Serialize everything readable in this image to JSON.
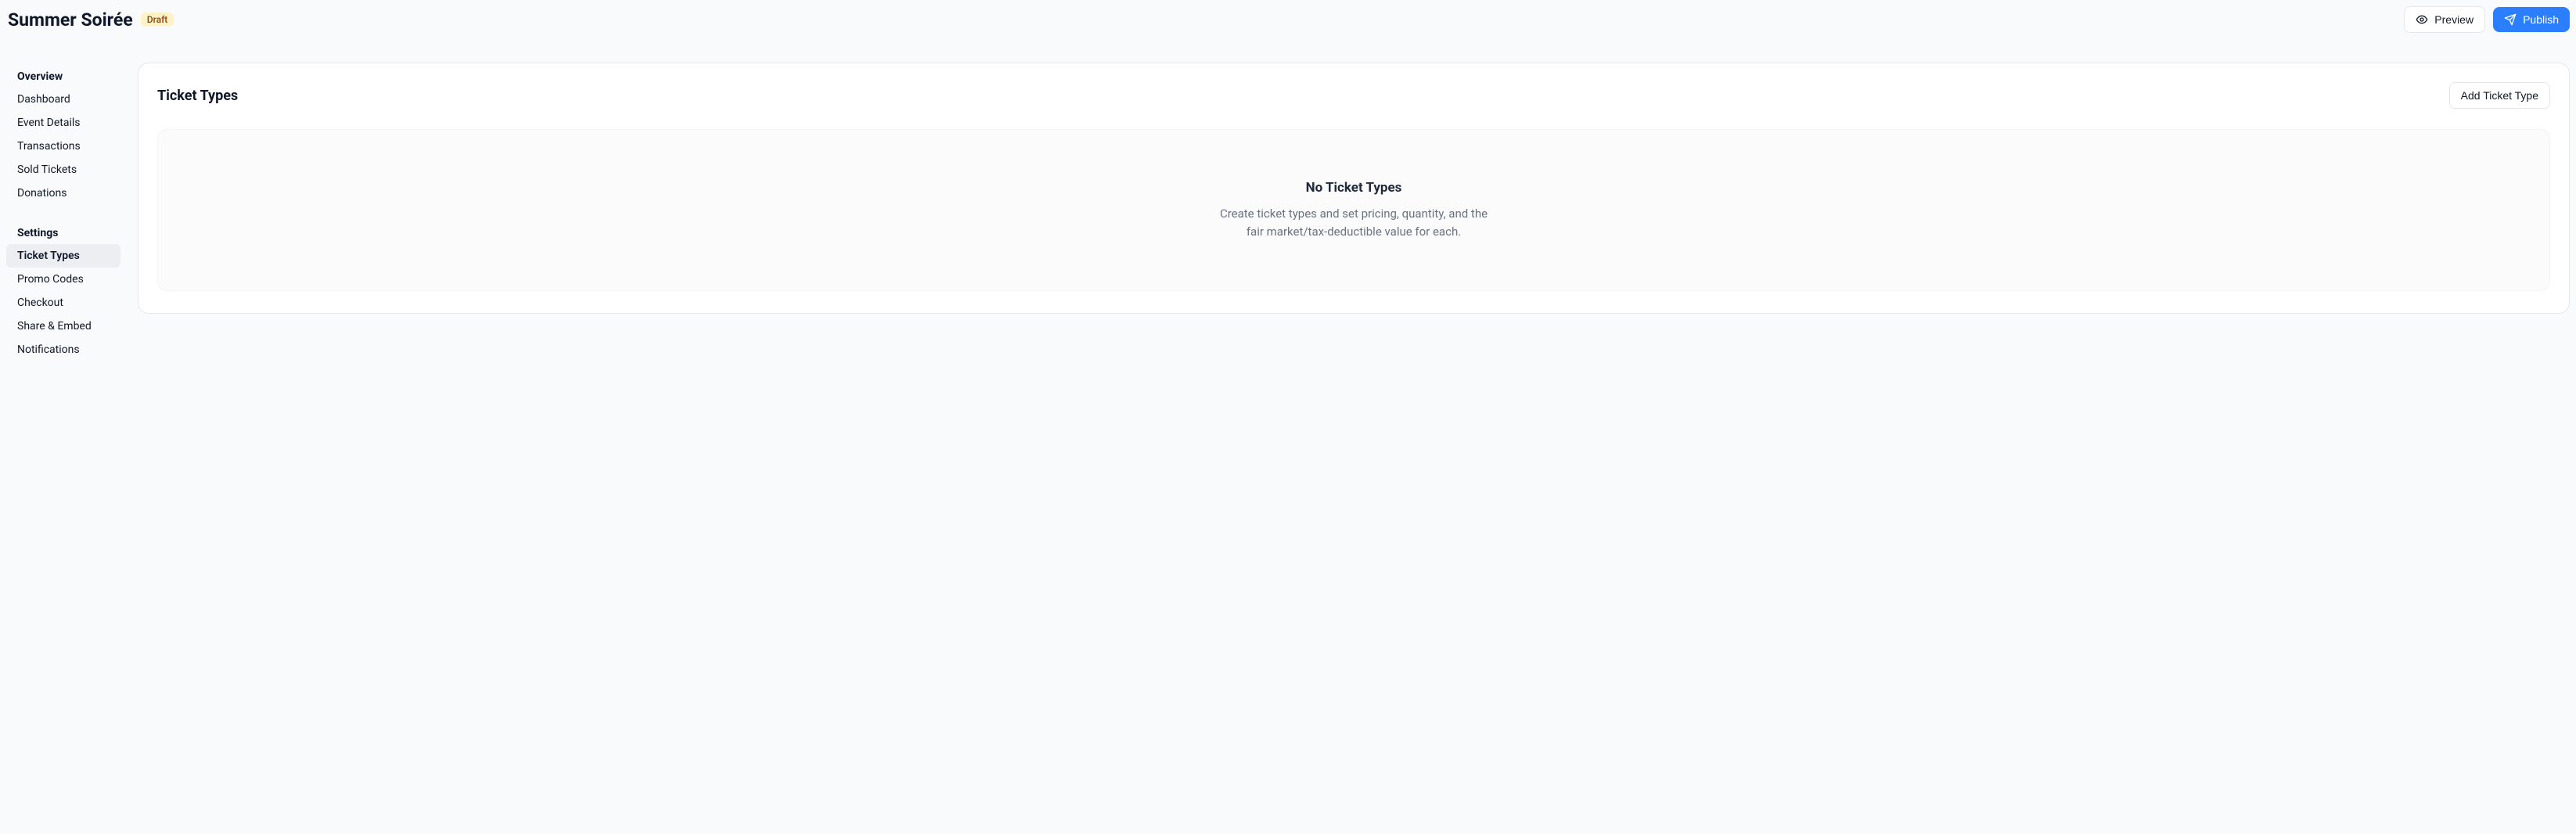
{
  "header": {
    "title": "Summer Soirée",
    "badge": "Draft",
    "preview_label": "Preview",
    "publish_label": "Publish"
  },
  "sidebar": {
    "sections": {
      "overview": {
        "title": "Overview",
        "items": [
          {
            "label": "Dashboard"
          },
          {
            "label": "Event Details"
          },
          {
            "label": "Transactions"
          },
          {
            "label": "Sold Tickets"
          },
          {
            "label": "Donations"
          }
        ]
      },
      "settings": {
        "title": "Settings",
        "items": [
          {
            "label": "Ticket Types"
          },
          {
            "label": "Promo Codes"
          },
          {
            "label": "Checkout"
          },
          {
            "label": "Share & Embed"
          },
          {
            "label": "Notifications"
          }
        ]
      }
    }
  },
  "main": {
    "card_title": "Ticket Types",
    "add_button": "Add Ticket Type",
    "empty": {
      "title": "No Ticket Types",
      "description": "Create ticket types and set pricing, quantity, and the fair market/tax-deductible value for each."
    }
  }
}
